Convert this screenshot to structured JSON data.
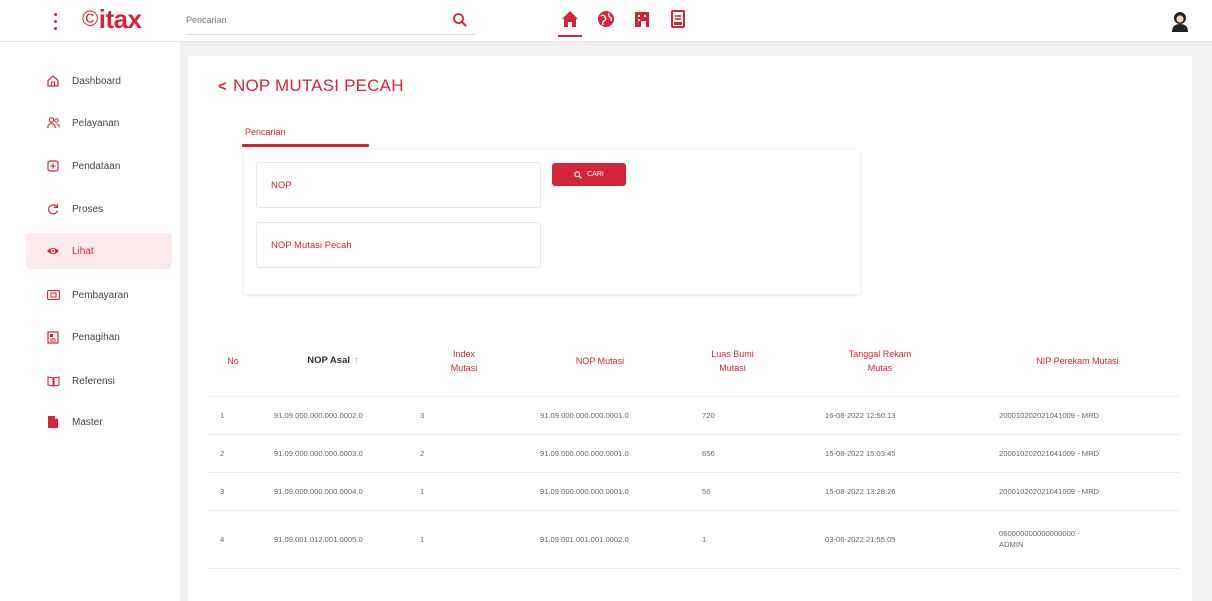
{
  "header": {
    "logo_text": "itax",
    "logo_mark": "©",
    "search_placeholder": "Pencarian",
    "nav_icons": [
      "home-icon",
      "globe-icon",
      "building-icon",
      "document-icon"
    ],
    "accent_color": "#d3263b"
  },
  "sidebar": {
    "items": [
      {
        "label": "Dashboard",
        "icon": "home-outline-icon"
      },
      {
        "label": "Pelayanan",
        "icon": "users-icon"
      },
      {
        "label": "Pendataan",
        "icon": "plus-square-icon"
      },
      {
        "label": "Proses",
        "icon": "refresh-icon"
      },
      {
        "label": "Lihat",
        "icon": "eye-icon",
        "active": true
      },
      {
        "label": "Pembayaran",
        "icon": "card-icon"
      },
      {
        "label": "Penagihan",
        "icon": "invoice-icon"
      },
      {
        "label": "Referensi",
        "icon": "book-icon"
      },
      {
        "label": "Master",
        "icon": "file-icon"
      }
    ]
  },
  "main": {
    "title": "NOP MUTASI PECAH",
    "tab_label": "Pencarian",
    "filters": {
      "nop_placeholder": "NOP",
      "nop_mutasi_placeholder": "NOP Mutasi Pecah",
      "search_button_label": "CARI"
    },
    "table": {
      "headers": {
        "no": "No",
        "nop_asal": "NOP Asal",
        "sort_indicator": "↑",
        "index_mutasi_1": "Index",
        "index_mutasi_2": "Mutasi",
        "nop_mutasi": "NOP Mutasi",
        "luas_1": "Luas Bumi",
        "luas_2": "Mutasi",
        "tanggal_1": "Tanggal Rekam",
        "tanggal_2": "Mutas",
        "nip": "NIP Perekam Mutasi"
      },
      "rows": [
        {
          "no": "1",
          "nop_asal": "91.09.000.000.000.0002.0",
          "index": "3",
          "nop_mutasi": "91.09.000.000.000.0001.0",
          "luas": "720",
          "tanggal": "16-08-2022 12:50:13",
          "nip": "200010202021041009 - MRD",
          "nip_2": ""
        },
        {
          "no": "2",
          "nop_asal": "91.09.000.000.000.0003.0",
          "index": "2",
          "nop_mutasi": "91.09.000.000.000.0001.0",
          "luas": "656",
          "tanggal": "15-08-2022 15:03:45",
          "nip": "200010202021041009 - MRD",
          "nip_2": ""
        },
        {
          "no": "3",
          "nop_asal": "91.09.000.000.000.0004.0",
          "index": "1",
          "nop_mutasi": "91.09.000.000.000.0001.0",
          "luas": "56",
          "tanggal": "15-08-2022 13:28:26",
          "nip": "200010202021041009 - MRD",
          "nip_2": ""
        },
        {
          "no": "4",
          "nop_asal": "91.09.001.012.001.0005.0",
          "index": "1",
          "nop_mutasi": "91.09.001.001.001.0002.0",
          "luas": "1",
          "tanggal": "03-06-2022 21:55:05",
          "nip": "060000000000000000 -",
          "nip_2": "ADMIN"
        }
      ]
    }
  }
}
